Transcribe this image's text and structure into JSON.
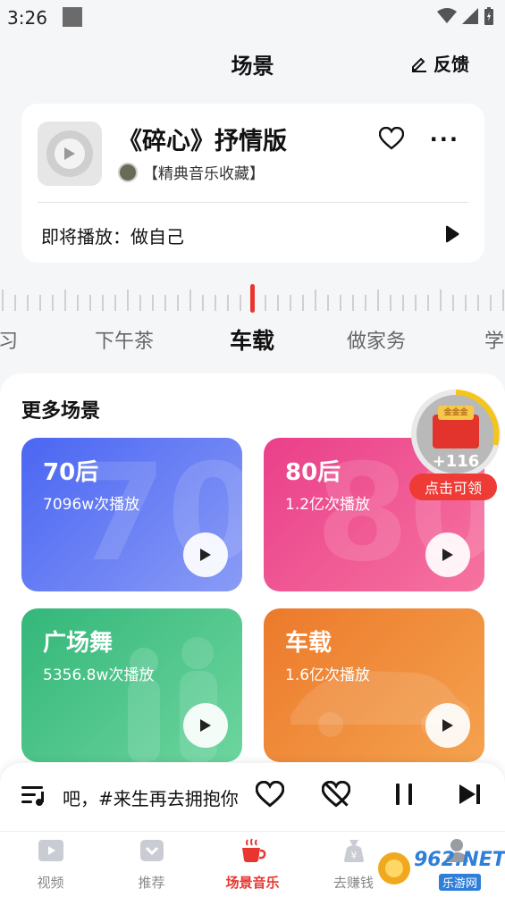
{
  "status_bar": {
    "time": "3:26"
  },
  "header": {
    "title": "场景",
    "feedback_label": "反馈"
  },
  "now_playing": {
    "title": "《碎心》抒情版",
    "album": "【精典音乐收藏】",
    "next_label": "即将播放：做自己"
  },
  "scene_tabs": [
    {
      "label": "习"
    },
    {
      "label": "下午茶"
    },
    {
      "label": "车载",
      "active": true
    },
    {
      "label": "做家务"
    },
    {
      "label": "学"
    }
  ],
  "more_scenes": {
    "title": "更多场景",
    "cards": [
      {
        "name": "70后",
        "plays": "7096w次播放",
        "big": "70",
        "colors": [
          "#4a66f2",
          "#8a9bf6"
        ]
      },
      {
        "name": "80后",
        "plays": "1.2亿次播放",
        "big": "80",
        "colors": [
          "#ea3f8a",
          "#f6739f"
        ]
      },
      {
        "name": "广场舞",
        "plays": "5356.8w次播放",
        "big": "",
        "colors": [
          "#34b77a",
          "#6dd59e"
        ]
      },
      {
        "name": "车载",
        "plays": "1.6亿次播放",
        "big": "",
        "colors": [
          "#ec7a2b",
          "#f4a24f"
        ]
      }
    ]
  },
  "reward": {
    "amount": "+116",
    "claim_label": "点击可领",
    "badge_text": "金金金"
  },
  "mini_player": {
    "lyrics": "吧，#来生再去拥抱你"
  },
  "tabbar": [
    {
      "label": "视频",
      "icon": "video-icon"
    },
    {
      "label": "推荐",
      "icon": "recommend-icon"
    },
    {
      "label": "场景音乐",
      "icon": "coffee-cup-icon",
      "active": true
    },
    {
      "label": "去赚钱",
      "icon": "money-bag-icon"
    },
    {
      "label": "我的",
      "icon": "profile-icon"
    }
  ],
  "watermark": {
    "text": "962.NET",
    "subtext": "乐游网"
  },
  "colors": {
    "accent": "#e8362f",
    "background": "#f5f6f8"
  }
}
